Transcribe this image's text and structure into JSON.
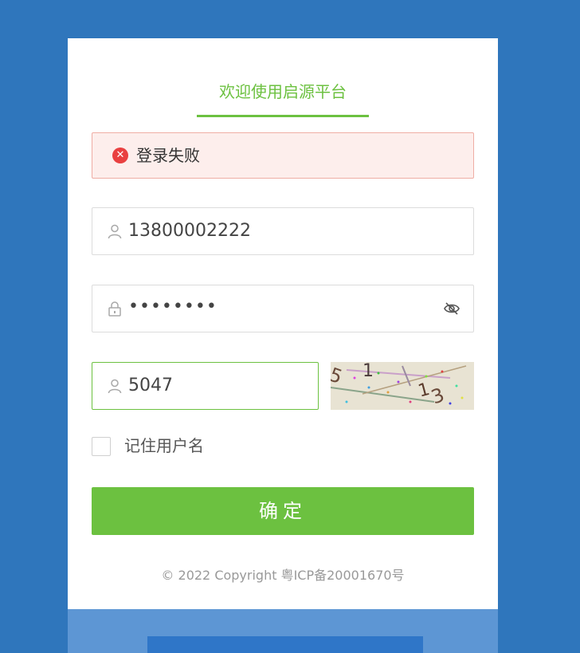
{
  "page": {
    "title": "欢迎使用启源平台"
  },
  "alert": {
    "message": "登录失败",
    "icon": "close-circle-icon",
    "color": "#e94040"
  },
  "form": {
    "phone": {
      "value": "13800002222",
      "icon": "user-icon"
    },
    "password": {
      "masked_value": "••••••••",
      "icon": "lock-icon",
      "toggle_icon": "eye-off-icon"
    },
    "captcha": {
      "value": "5047",
      "icon": "user-icon"
    },
    "remember_label": "记住用户名",
    "submit_label": "确定"
  },
  "footer": {
    "copyright": "© 2022 Copyright 粤ICP备20001670号"
  },
  "colors": {
    "background": "#2f76bc",
    "accent": "#6cc140",
    "alert_bg": "#fdeeec",
    "alert_border": "#efada4"
  }
}
